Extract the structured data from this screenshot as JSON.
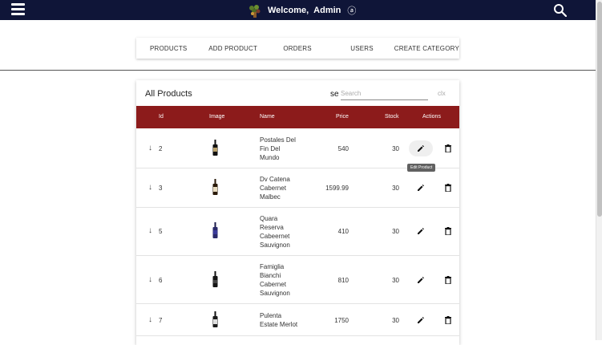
{
  "header": {
    "welcome": "Welcome,",
    "user": "Admin",
    "user_icon": "ⓐ",
    "bg_color": "#0f1538"
  },
  "nav": {
    "items": [
      "PRODUCTS",
      "ADD PRODUCT",
      "ORDERS",
      "USERS",
      "CREATE CATEGORY"
    ]
  },
  "products": {
    "title": "All Products",
    "search_prefix": "se",
    "search_placeholder": "Search",
    "clear_label": "clx",
    "header_color": "#8c1b1b",
    "columns": [
      "Id",
      "Image",
      "Name",
      "Price",
      "Stock",
      "Actions"
    ],
    "rows": [
      {
        "id": "2",
        "name_lines": [
          "Postales Del",
          "Fin Del",
          "Mundo"
        ],
        "price": "540",
        "stock": "30"
      },
      {
        "id": "3",
        "name_lines": [
          "Dv Catena",
          "Cabernet",
          "Malbec"
        ],
        "price": "1599.99",
        "stock": "30"
      },
      {
        "id": "5",
        "name_lines": [
          "Quara",
          "Reserva",
          "Cabeernet",
          "Sauvignon"
        ],
        "price": "410",
        "stock": "30"
      },
      {
        "id": "6",
        "name_lines": [
          "Famiglia",
          "Bianchi",
          "Cabernet",
          "Sauvignon"
        ],
        "price": "810",
        "stock": "30"
      },
      {
        "id": "7",
        "name_lines": [
          "Pulenta",
          "Estate Merlot"
        ],
        "price": "1750",
        "stock": "30"
      }
    ],
    "tooltip": "Edit Product"
  }
}
